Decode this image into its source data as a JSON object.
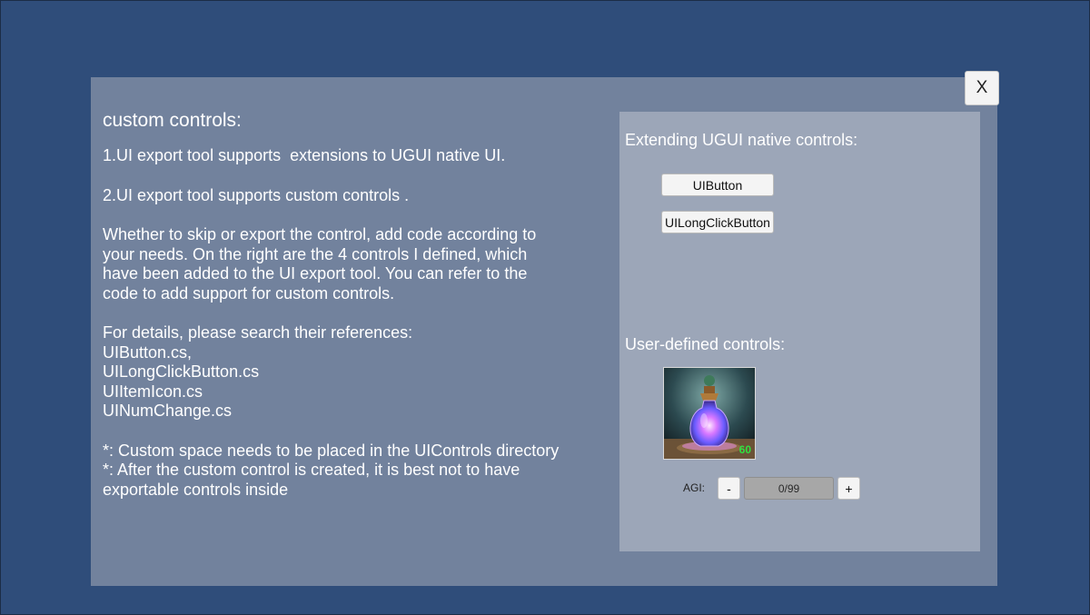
{
  "close_button": {
    "label": "X"
  },
  "left": {
    "title": "custom controls:",
    "p1": "1.UI export tool supports  extensions to UGUI native UI.",
    "p2": "2.UI export tool supports custom controls .",
    "p3_lines": [
      "Whether to skip or export the control, add code according to",
      "your needs. On the right are the 4 controls I defined, which",
      "have been added to the UI export tool. You can refer to the",
      "code to add support for custom controls."
    ],
    "p4_lines": [
      "For details, please search their references:",
      "UIButton.cs,",
      "UILongClickButton.cs",
      "UIItemIcon.cs",
      "UINumChange.cs"
    ],
    "p5_lines": [
      "*: Custom space needs to be placed in the UIControls directory",
      "*: After the custom control is created, it is best not to have",
      "exportable controls inside"
    ]
  },
  "right": {
    "native_title": "Extending UGUI native controls:",
    "ui_button_label": "UIButton",
    "long_click_button_label": "UILongClickButton",
    "user_title": "User-defined controls:",
    "item_icon": {
      "icon": "potion-bottle-icon",
      "count": "60"
    },
    "num_change": {
      "label": "AGI:",
      "minus": "-",
      "value": "0/99",
      "plus": "+"
    }
  },
  "colors": {
    "background": "#2f4d7a",
    "panel": "#72829d",
    "right_panel": "#9ca6b8",
    "count_text": "#30e040"
  }
}
